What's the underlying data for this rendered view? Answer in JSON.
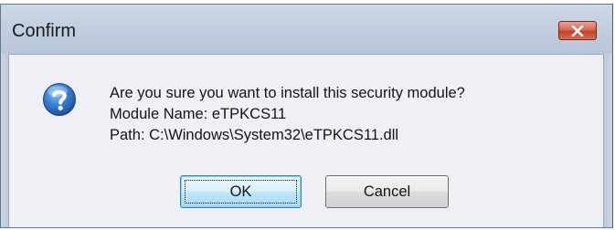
{
  "window": {
    "title": "Confirm"
  },
  "icons": {
    "close": "close-icon",
    "question": "question-icon"
  },
  "message": {
    "line1": "Are you sure you want to install this security module?",
    "line2": "Module Name: eTPKCS11",
    "line3": "Path: C:\\Windows\\System32\\eTPKCS11.dll"
  },
  "buttons": {
    "ok_label": "OK",
    "cancel_label": "Cancel"
  },
  "colors": {
    "close_button": "#c3432c",
    "question_icon": "#1f5fb0"
  }
}
